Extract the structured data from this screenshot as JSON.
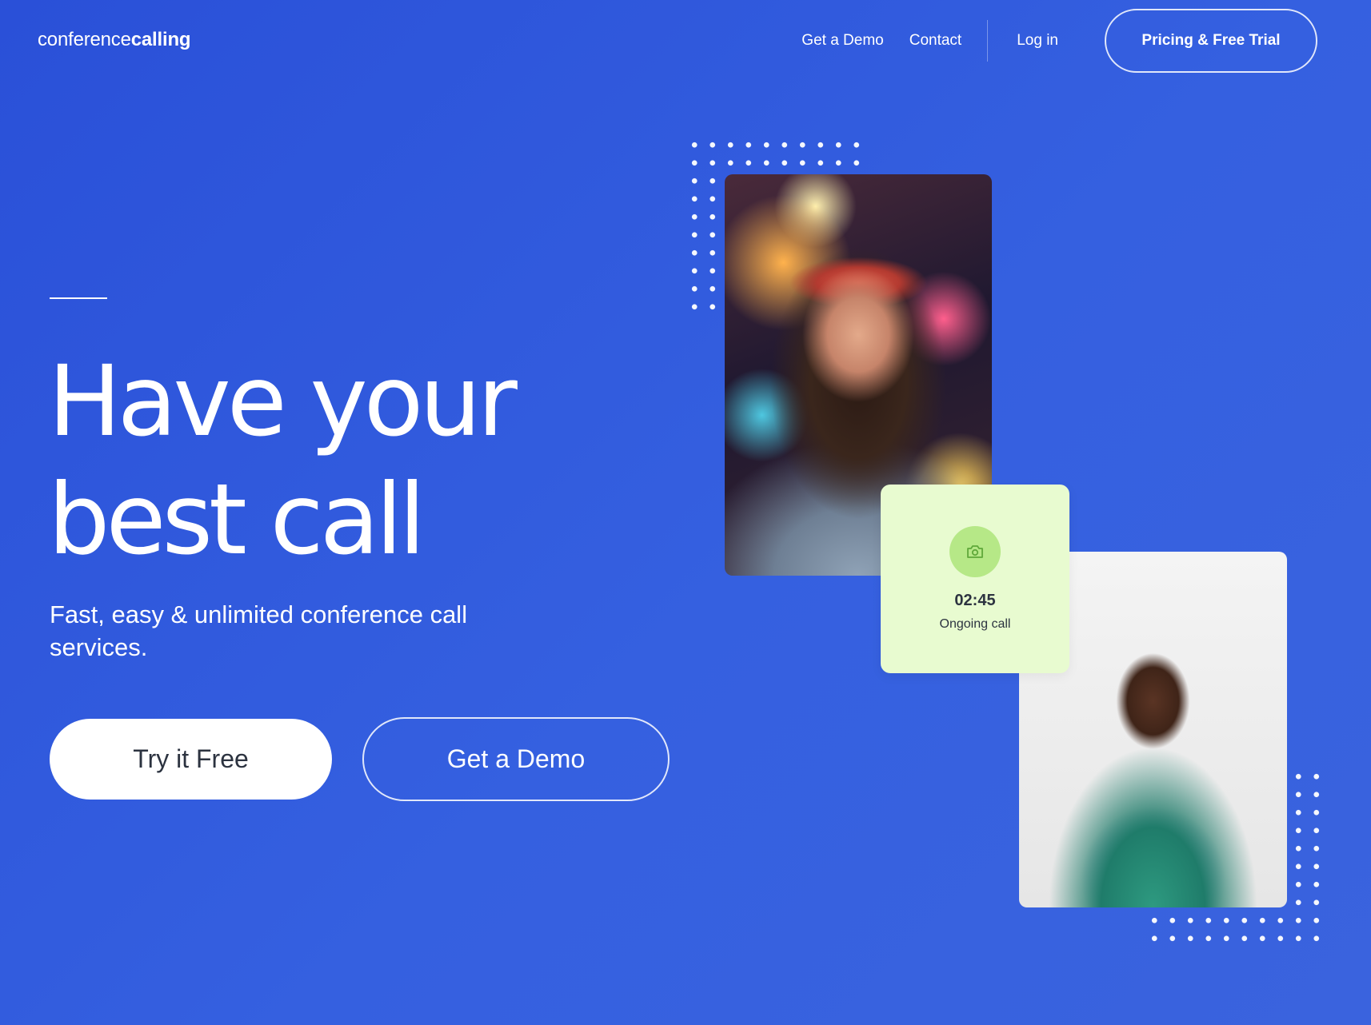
{
  "brand": {
    "logo_light": "conference",
    "logo_bold": "calling"
  },
  "nav": {
    "demo_label": "Get a Demo",
    "contact_label": "Contact",
    "login_label": "Log in",
    "pricing_label": "Pricing & Free Trial"
  },
  "hero": {
    "headline_line1": "Have your",
    "headline_line2": "best call",
    "subhead": "Fast, easy & unlimited conference call services.",
    "primary_cta": "Try it Free",
    "secondary_cta": "Get a Demo"
  },
  "call_card": {
    "icon": "camera-icon",
    "time": "02:45",
    "status": "Ongoing call"
  },
  "colors": {
    "background": "#3560e0",
    "card_background": "#e8fbd0",
    "card_icon_background": "#b6e887",
    "dark_text": "#2c3340"
  }
}
